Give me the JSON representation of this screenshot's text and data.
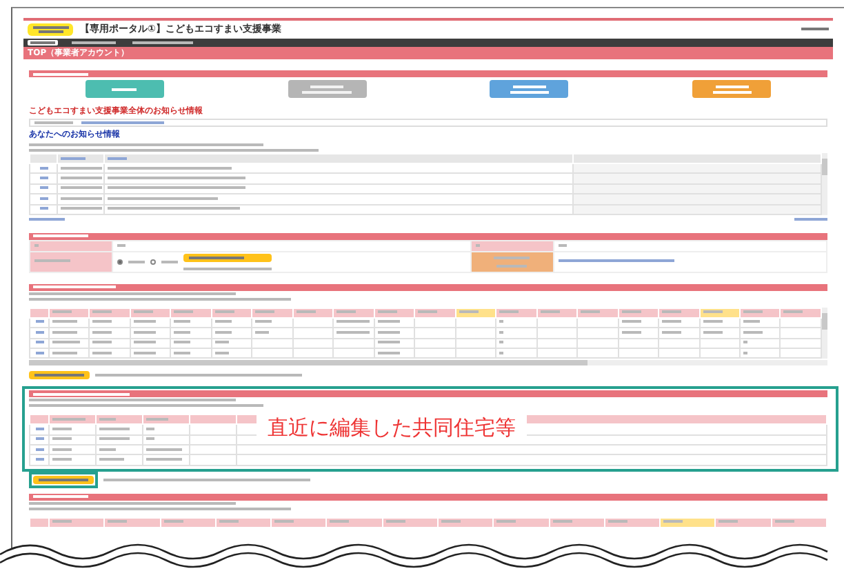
{
  "header": {
    "title": "【専用ポータル①】こどもエコすまい支援事業"
  },
  "nav": [
    {
      "selected": true
    },
    {
      "selected": false
    },
    {
      "selected": false
    }
  ],
  "page_title": "TOP（事業者アカウント）",
  "portal_buttons": [
    {
      "color": "#4dbdb0",
      "disabled": false
    },
    {
      "color": "#b5b5b5",
      "disabled": true
    },
    {
      "color": "#5fa3dc",
      "disabled": false
    },
    {
      "color": "#f0a038",
      "disabled": false
    }
  ],
  "global_news": {
    "heading": "こどもエコすまい支援事業全体のお知らせ情報"
  },
  "my_news": {
    "heading": "あなたへのお知らせ情報"
  },
  "account": {
    "mail_options": [
      {
        "selected": true
      },
      {
        "selected": false
      }
    ]
  },
  "applications": {
    "columns": [
      {
        "highlight": false
      },
      {
        "highlight": false
      },
      {
        "highlight": false
      },
      {
        "highlight": false
      },
      {
        "highlight": false
      },
      {
        "highlight": false
      },
      {
        "highlight": false
      },
      {
        "highlight": false
      },
      {
        "highlight": false
      },
      {
        "highlight": false
      },
      {
        "highlight": true
      },
      {
        "highlight": false
      },
      {
        "highlight": false
      },
      {
        "highlight": false
      },
      {
        "highlight": false
      },
      {
        "highlight": false
      },
      {
        "highlight": true
      },
      {
        "highlight": false
      },
      {
        "highlight": false
      }
    ]
  },
  "apartments": {
    "callout": "直近に編集した共同住宅等"
  },
  "reports": {
    "columns": [
      {
        "highlight": false
      },
      {
        "highlight": false
      },
      {
        "highlight": false
      },
      {
        "highlight": false
      },
      {
        "highlight": false
      },
      {
        "highlight": false
      },
      {
        "highlight": false
      },
      {
        "highlight": false
      },
      {
        "highlight": false
      },
      {
        "highlight": false
      },
      {
        "highlight": false
      },
      {
        "highlight": true
      },
      {
        "highlight": false
      },
      {
        "highlight": false
      }
    ]
  }
}
